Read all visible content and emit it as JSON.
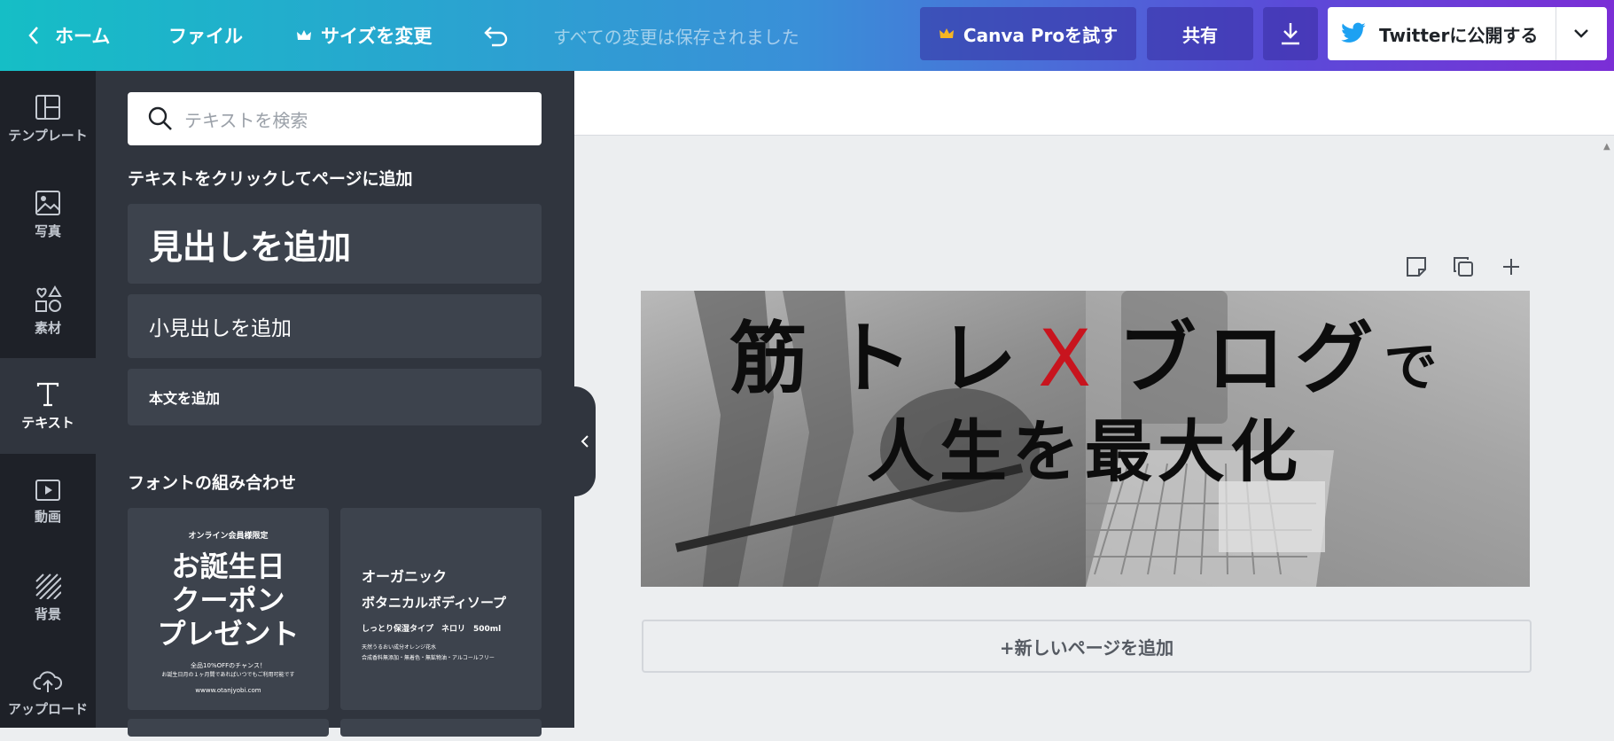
{
  "topbar": {
    "home_label": "ホーム",
    "file_label": "ファイル",
    "resize_label": "サイズを変更",
    "save_status": "すべての変更は保存されました",
    "pro_label": "Canva Proを試す",
    "share_label": "共有",
    "publish_label": "Twitterに公開する"
  },
  "sidebar": {
    "items": [
      {
        "label": "テンプレート",
        "icon": "template-icon"
      },
      {
        "label": "写真",
        "icon": "photo-icon"
      },
      {
        "label": "素材",
        "icon": "elements-icon"
      },
      {
        "label": "テキスト",
        "icon": "text-icon"
      },
      {
        "label": "動画",
        "icon": "video-icon"
      },
      {
        "label": "背景",
        "icon": "background-icon"
      },
      {
        "label": "アップロード",
        "icon": "upload-icon"
      }
    ]
  },
  "panel": {
    "search_placeholder": "テキストを検索",
    "click_title": "テキストをクリックしてページに追加",
    "heading_label": "見出しを追加",
    "subheading_label": "小見出しを追加",
    "body_label": "本文を追加",
    "combo_title": "フォントの組み合わせ",
    "combo1": {
      "small_top": "オンライン会員様限定",
      "big": [
        "お誕生日",
        "クーポン",
        "プレゼント"
      ],
      "line1": "全品10%OFFのチャンス！",
      "line2": "お誕生日月の１ヶ月間であればいつでもご利用可能です",
      "url": "wwww.otanjyobi.com"
    },
    "combo2": {
      "title1": "オーガニック",
      "title2": "ボタニカルボディソープ",
      "sub": "しっとり保湿タイプ　ネロリ　500ml",
      "line1": "天然うるおい成分オレンジ花水",
      "line2": "合成香料無添加・無着色・無鉱物油・アルコールフリー"
    }
  },
  "design": {
    "line1_a": "筋トレ",
    "line1_x": "X",
    "line1_b": "ブログ",
    "line1_c": "で",
    "line2": "人生を最大化",
    "x_color": "#c8141e"
  },
  "canvas": {
    "add_page_label": "+新しいページを追加"
  }
}
